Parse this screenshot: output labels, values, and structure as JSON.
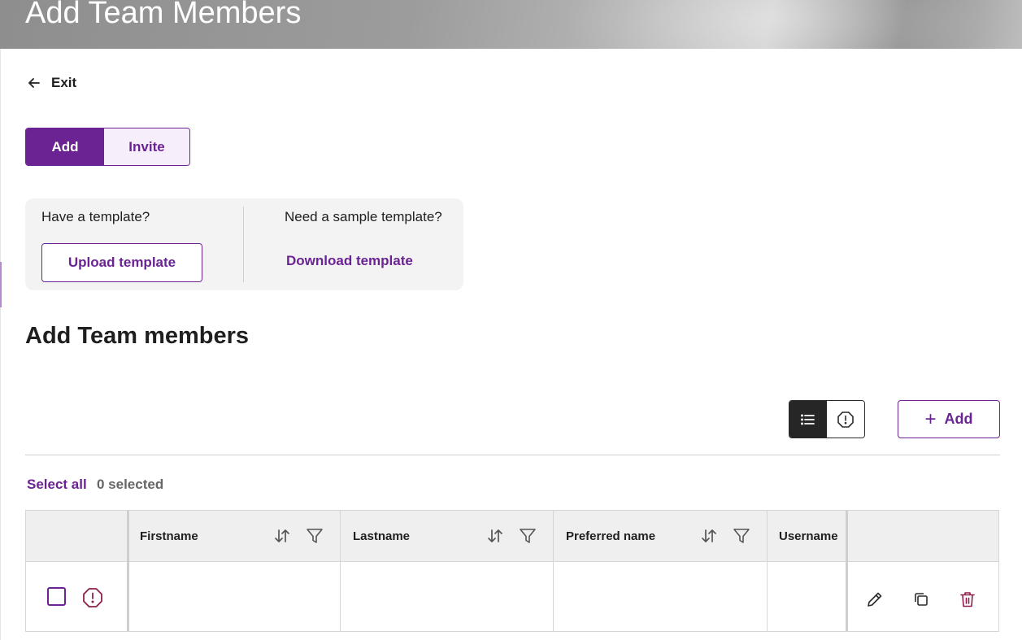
{
  "header": {
    "title": "Add Team Members"
  },
  "nav": {
    "exit_label": "Exit"
  },
  "mode_toggle": {
    "add_label": "Add",
    "invite_label": "Invite",
    "selected": "Add"
  },
  "template": {
    "have_question": "Have a template?",
    "upload_label": "Upload template",
    "sample_question": "Need a sample template?",
    "download_label": "Download template"
  },
  "section": {
    "title": "Add Team members"
  },
  "toolbar": {
    "add_label": "Add",
    "view_list_icon": "list-icon",
    "view_errors_icon": "alert-octagon-icon"
  },
  "selection": {
    "select_all_label": "Select all",
    "selected_count": "0 selected"
  },
  "table": {
    "columns": [
      {
        "label": "Firstname",
        "sortable": true,
        "filterable": true
      },
      {
        "label": "Lastname",
        "sortable": true,
        "filterable": true
      },
      {
        "label": "Preferred name",
        "sortable": true,
        "filterable": true
      },
      {
        "label": "Username",
        "sortable": false,
        "filterable": false
      }
    ],
    "rows": [
      {
        "checked": false,
        "firstname": "",
        "lastname": "",
        "preferred_name": "",
        "username": "",
        "has_error": true
      }
    ],
    "row_actions": [
      "edit-icon",
      "copy-icon",
      "trash-icon"
    ]
  },
  "colors": {
    "accent": "#6b2394",
    "error": "#8e1f4c",
    "dark": "#262626"
  }
}
